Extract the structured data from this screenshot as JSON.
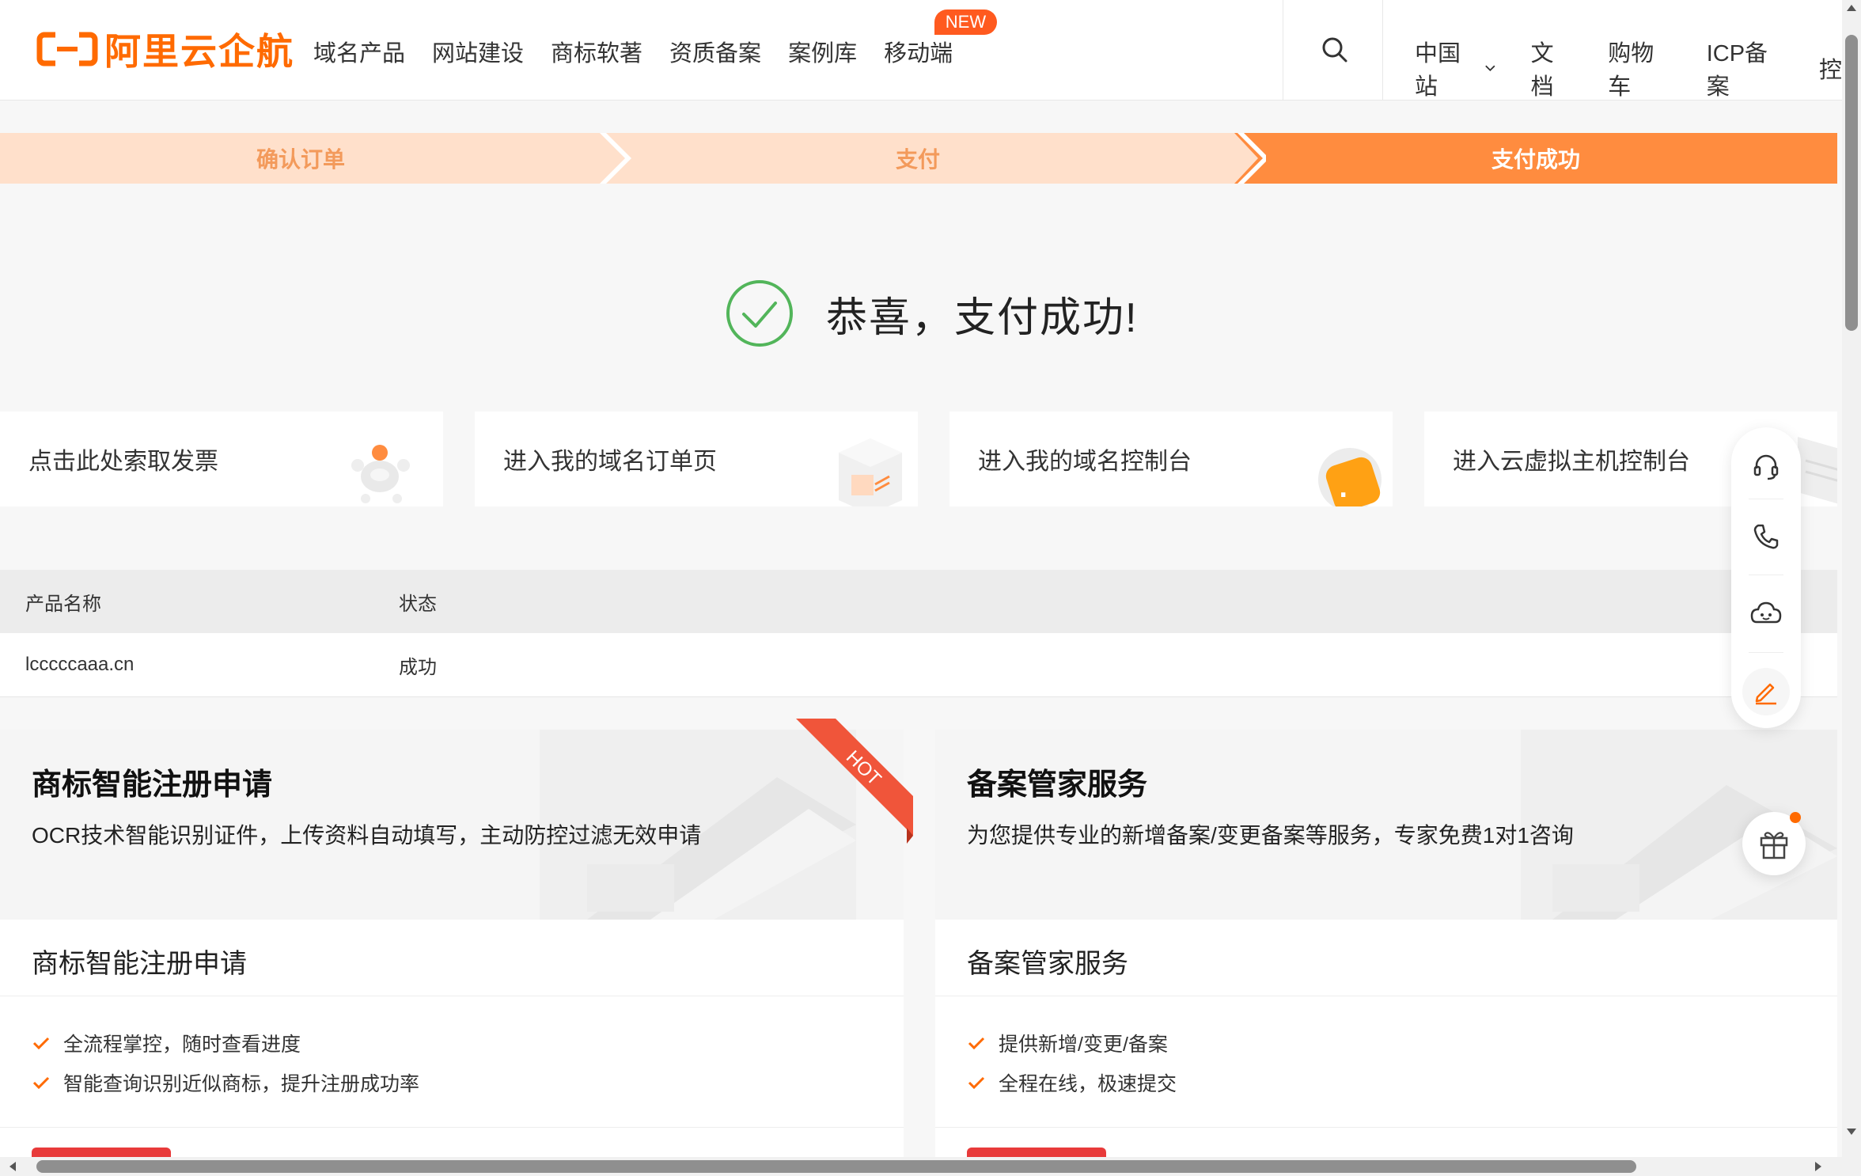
{
  "brand": {
    "logo_text": "阿里云企航",
    "accent": "#ff6a00"
  },
  "nav": {
    "items": [
      "域名产品",
      "网站建设",
      "商标软著",
      "资质备案",
      "案例库",
      "移动端"
    ],
    "new_badge": "NEW"
  },
  "right_nav": {
    "site": "中国站",
    "docs": "文档",
    "cart": "购物车",
    "icp": "ICP备案",
    "cut_off": "控"
  },
  "steps": {
    "step1": "确认订单",
    "step2": "支付",
    "step3": "支付成功",
    "active_color": "#ff8c3f",
    "inactive_color": "#ffe0cb"
  },
  "success": {
    "message": "恭喜，支付成功!"
  },
  "quick_links": [
    {
      "label": "点击此处索取发票"
    },
    {
      "label": "进入我的域名订单页"
    },
    {
      "label": "进入我的域名控制台"
    },
    {
      "label": "进入云虚拟主机控制台"
    }
  ],
  "table": {
    "headers": [
      "产品名称",
      "状态"
    ],
    "rows": [
      [
        "lcccccaaa.cn",
        "成功"
      ]
    ]
  },
  "promos": [
    {
      "title": "商标智能注册申请",
      "subtitle": "OCR技术智能识别证件，上传资料自动填写，主动防控过滤无效申请",
      "name": "商标智能注册申请",
      "features": [
        "全流程掌控，随时查看进度",
        "智能查询识别近似商标，提升注册成功率"
      ],
      "ribbon": "HOT"
    },
    {
      "title": "备案管家服务",
      "subtitle": "为您提供专业的新增备案/变更备案等服务，专家免费1对1咨询",
      "name": "备案管家服务",
      "features": [
        "提供新增/变更/备案",
        "全程在线，极速提交"
      ]
    }
  ]
}
